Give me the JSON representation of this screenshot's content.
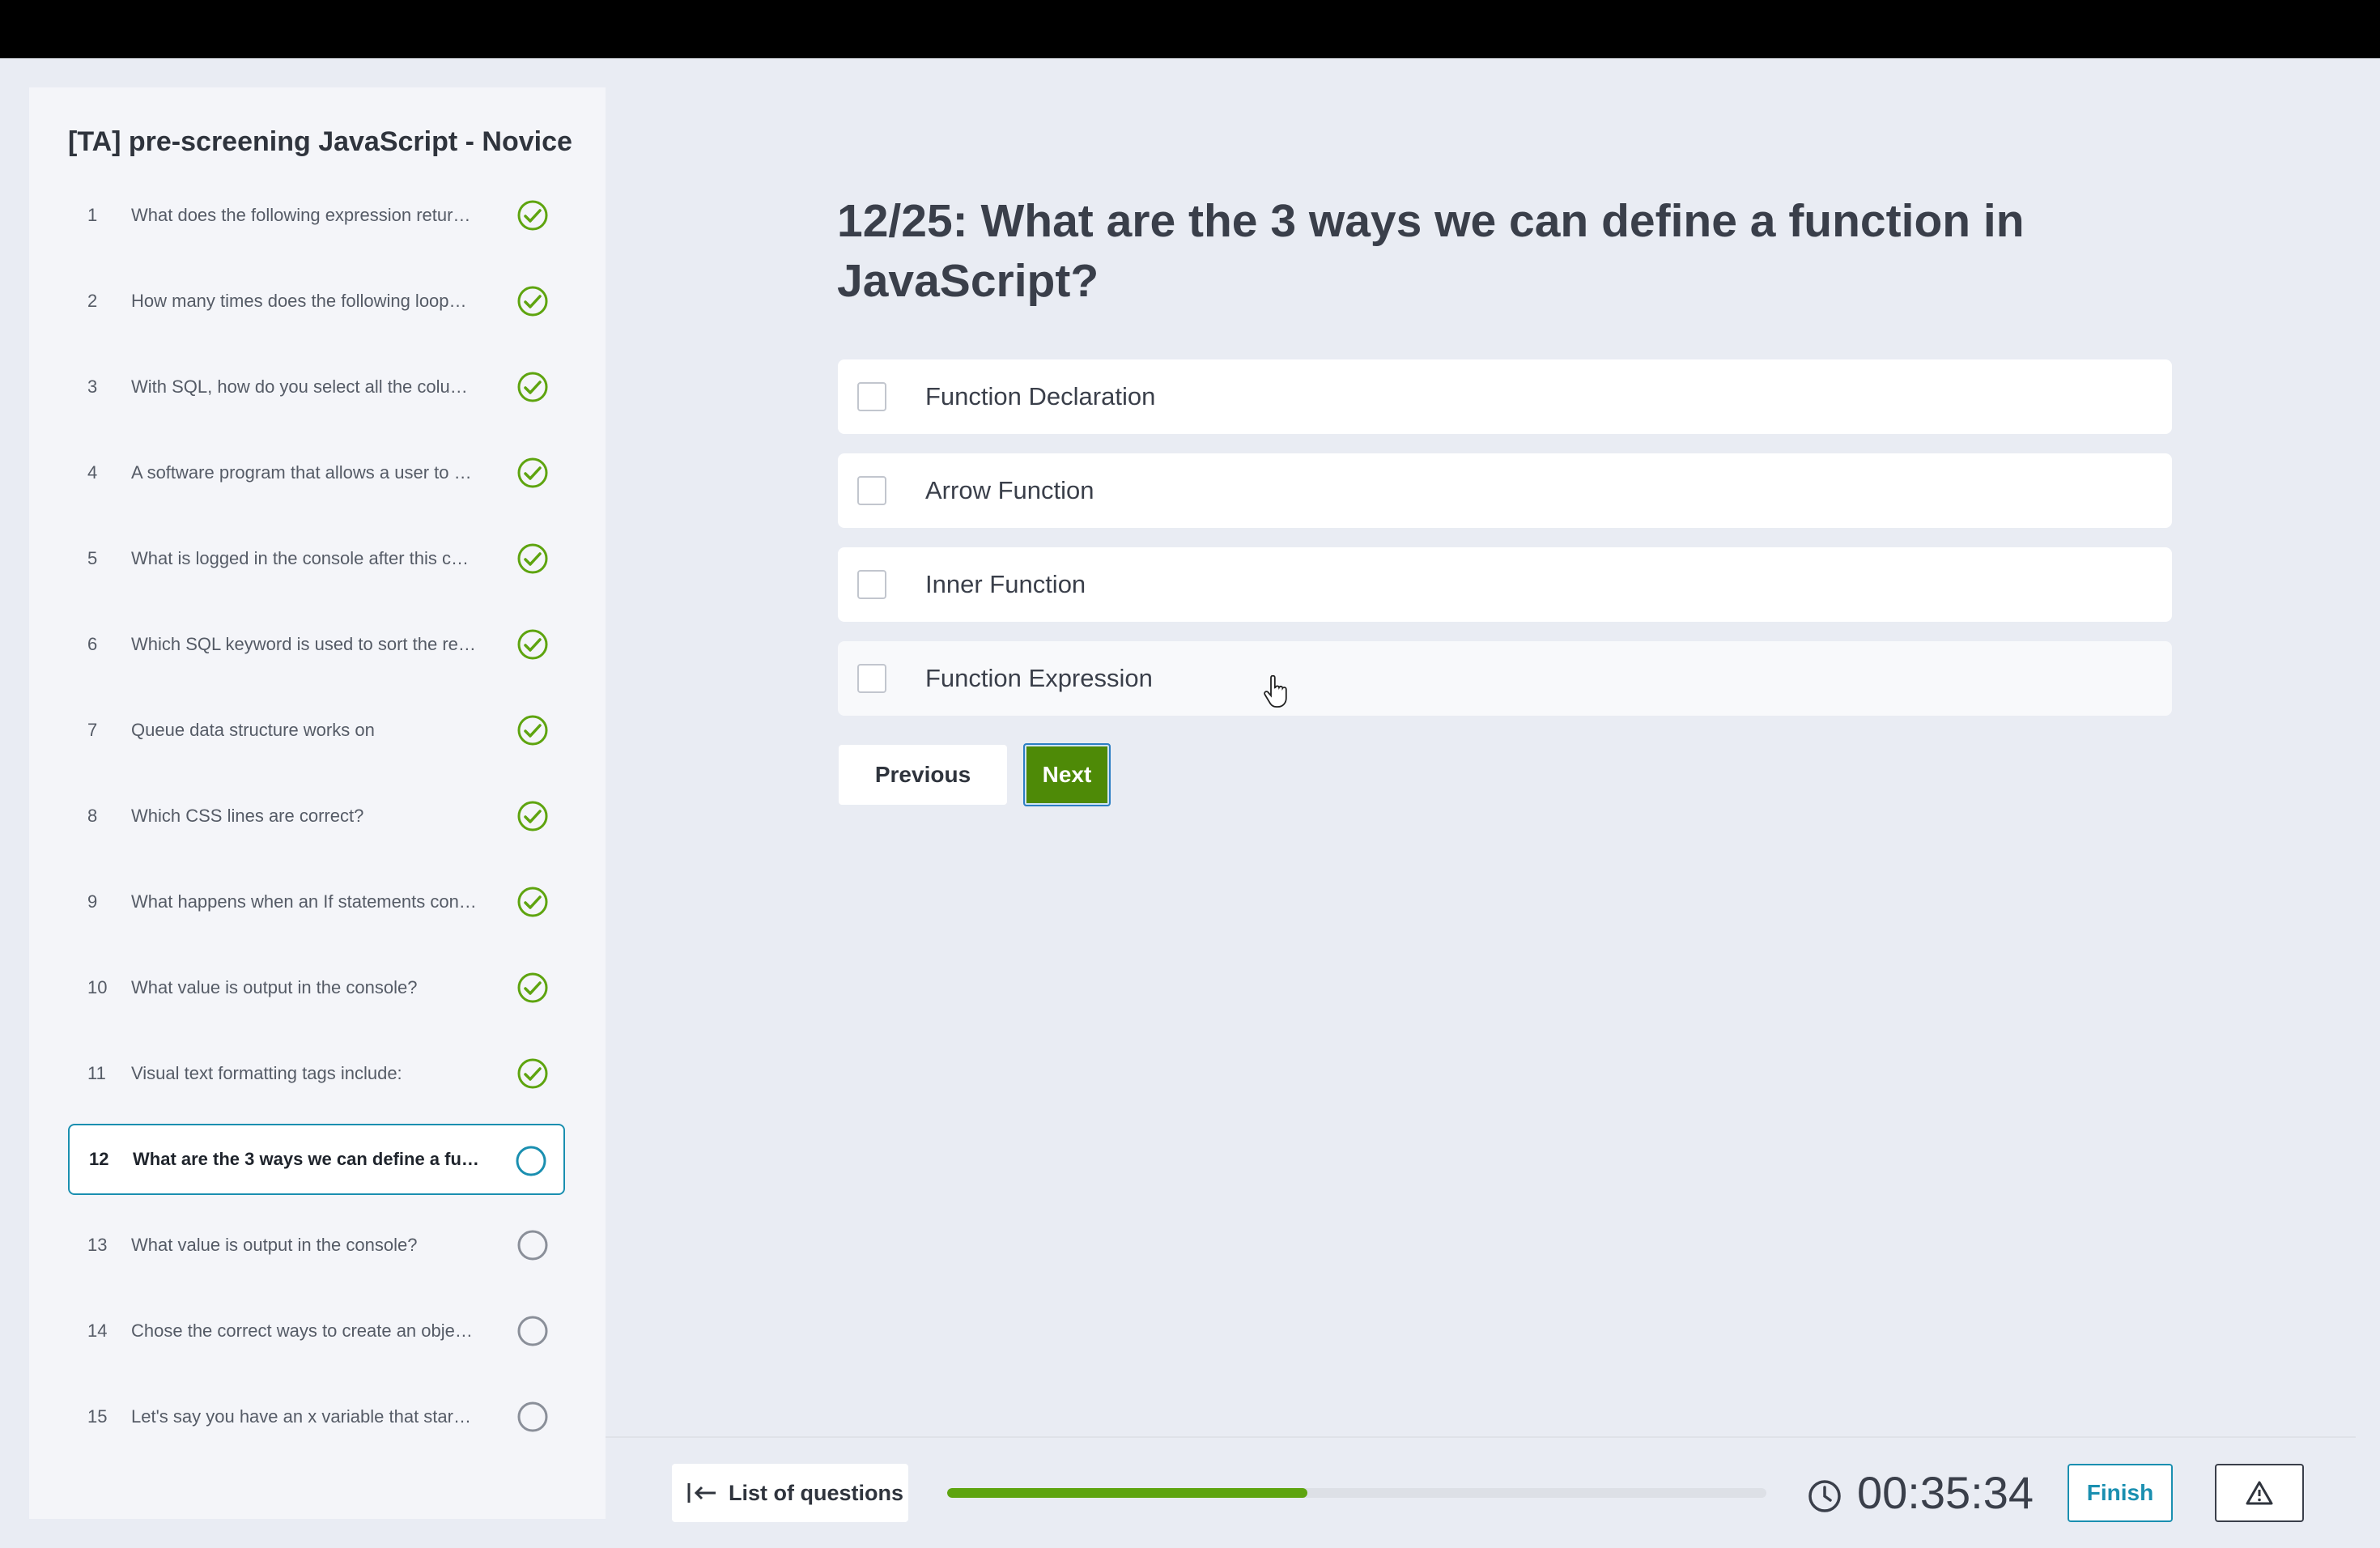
{
  "test": {
    "title": "[TA] pre-screening JavaScript - Novice"
  },
  "questions": [
    {
      "num": "1",
      "text": "What does the following expression retur…",
      "status": "answered"
    },
    {
      "num": "2",
      "text": "How many times does the following loop…",
      "status": "answered"
    },
    {
      "num": "3",
      "text": "With SQL, how do you select all the colu…",
      "status": "answered"
    },
    {
      "num": "4",
      "text": "A software program that allows a user to …",
      "status": "answered"
    },
    {
      "num": "5",
      "text": "What is logged in the console after this c…",
      "status": "answered"
    },
    {
      "num": "6",
      "text": "Which SQL keyword is used to sort the re…",
      "status": "answered"
    },
    {
      "num": "7",
      "text": "Queue data structure works on",
      "status": "answered"
    },
    {
      "num": "8",
      "text": "Which CSS lines are correct?",
      "status": "answered"
    },
    {
      "num": "9",
      "text": "What happens when an If statements con…",
      "status": "answered"
    },
    {
      "num": "10",
      "text": "What value is output in the console?",
      "status": "answered"
    },
    {
      "num": "11",
      "text": "Visual text formatting tags include:",
      "status": "answered"
    },
    {
      "num": "12",
      "text": "What are the 3 ways we can define a func…",
      "status": "current"
    },
    {
      "num": "13",
      "text": "What value is output in the console?",
      "status": "unanswered"
    },
    {
      "num": "14",
      "text": "Chose the correct ways to create an obje…",
      "status": "unanswered"
    },
    {
      "num": "15",
      "text": "Let's say you have an x variable that star…",
      "status": "unanswered"
    }
  ],
  "current_question": {
    "title": "12/25: What are the 3 ways we can define a function in JavaScript?",
    "options": [
      {
        "label": "Function Declaration",
        "checked": false
      },
      {
        "label": "Arrow Function",
        "checked": false
      },
      {
        "label": "Inner Function",
        "checked": false
      },
      {
        "label": "Function Expression",
        "checked": false
      }
    ]
  },
  "nav": {
    "previous_label": "Previous",
    "next_label": "Next"
  },
  "footer": {
    "list_label": "List of questions",
    "progress_fraction": 0.44,
    "timer": "00:35:34",
    "finish_label": "Finish"
  },
  "colors": {
    "accent": "#1a8fb0",
    "success": "#5ea40f",
    "next_button": "#4e8a07",
    "unanswered_ring": "#8a8f99"
  },
  "icons": {
    "answered": "check-circle-icon",
    "current": "circle-icon",
    "unanswered": "circle-icon",
    "list": "arrow-left-bar-icon",
    "timer": "clock-icon",
    "report": "warning-icon"
  }
}
